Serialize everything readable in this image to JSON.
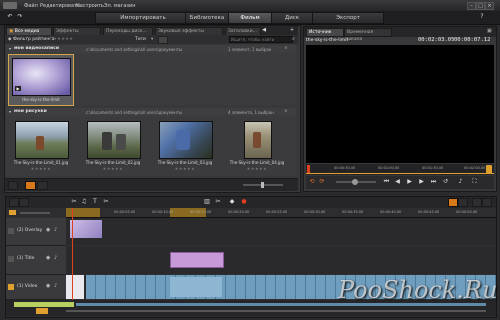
{
  "menu": {
    "items": [
      "Файл",
      "Редактировать",
      "Настроить",
      "Эл. магазин"
    ]
  },
  "window": {
    "minimize": "–",
    "maximize": "□",
    "close": "×"
  },
  "modes": {
    "import": "Импортировать",
    "library": "Библиотека",
    "movie": "Фильм",
    "disc": "Диск",
    "export": "Экспорт"
  },
  "library": {
    "tabs": [
      "Все медиа",
      "Эффекты перех...",
      "Переходы диск...",
      "Звуковые эффекты диск...",
      "Заголовки..."
    ],
    "filter_label": "Фильтр рейтинга",
    "tags_label": "Теги",
    "search_placeholder": "Ищите, чтобы найти",
    "videos": {
      "path": "c:\\documents and settings\\all users\\документы",
      "count": "1 элемент, 1 выбран",
      "title": "мои видеозаписи",
      "items": [
        {
          "caption": "the-sky-is-the-limit"
        }
      ]
    },
    "pictures": {
      "path": "c:\\documents and settings\\all users\\документы",
      "count": "4 элемента, 1 выбран",
      "title": "мои рисунки",
      "items": [
        {
          "caption": "The-Sky-is-the-Limit_01.jpg"
        },
        {
          "caption": "The-Sky-is-the-Limit_02.jpg"
        },
        {
          "caption": "The-Sky-is-the-Limit_03.jpg"
        },
        {
          "caption": "The-Sky-is-the-Limit_04.jpg"
        }
      ]
    },
    "stars": "★★★★★"
  },
  "viewer": {
    "tabs": [
      "Источник",
      "Временная шкала"
    ],
    "clip_name": "the-sky-is-the-limit",
    "timecode_a": "00:02:03.05",
    "timecode_b": "00:00:07.12",
    "ruler": [
      "00:00:30.00",
      "00:01:00.00",
      "00:01:30.00",
      "00:02:00.00"
    ]
  },
  "timeline": {
    "ruler": [
      "00:00:05.00",
      "00:00:10.00",
      "00:00:15.00",
      "00:00:20.00",
      "00:00:25.00",
      "00:00:30.00",
      "00:00:35.00",
      "00:00:40.00",
      "00:00:45.00",
      "00:00:50.00",
      "00:00:55.00"
    ],
    "tracks": [
      {
        "name": "(2) Overlay"
      },
      {
        "name": "(1) Title"
      },
      {
        "name": "(1) Video"
      }
    ]
  },
  "watermark": "PooShock.Ru",
  "colors": {
    "clip": "#6f9dbd",
    "title_clip": "#c59ad6",
    "marker": "#e0a030",
    "playhead": "#e04020"
  }
}
